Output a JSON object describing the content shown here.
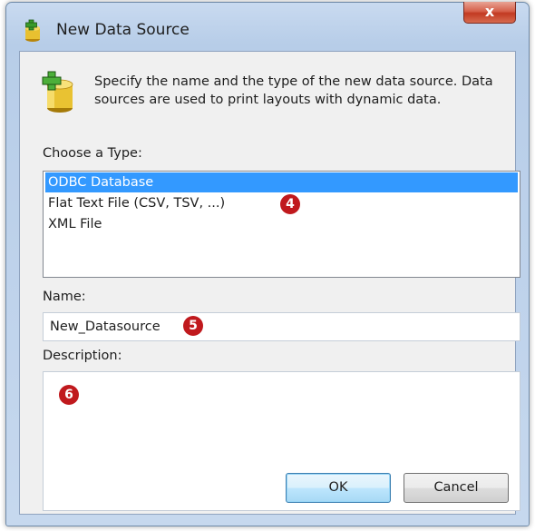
{
  "window": {
    "title": "New Data Source",
    "close_label": "x"
  },
  "intro": {
    "text": "Specify the name and the type of the new data source. Data sources are used to print layouts with dynamic data."
  },
  "type_section": {
    "label": "Choose a Type:",
    "items": [
      {
        "label": "ODBC Database",
        "selected": true
      },
      {
        "label": "Flat Text File (CSV, TSV, ...)",
        "selected": false
      },
      {
        "label": "XML File",
        "selected": false
      }
    ]
  },
  "name_section": {
    "label": "Name:",
    "value": "New_Datasource"
  },
  "description_section": {
    "label": "Description:",
    "value": ""
  },
  "buttons": {
    "ok": "OK",
    "cancel": "Cancel"
  },
  "annotations": {
    "marker_4": "4",
    "marker_5": "5",
    "marker_6": "6"
  },
  "colors": {
    "selection": "#3399ff",
    "marker": "#c0191d",
    "close_button": "#c23a22"
  },
  "icons": {
    "app": "data-source-icon",
    "banner": "database-add-icon"
  }
}
